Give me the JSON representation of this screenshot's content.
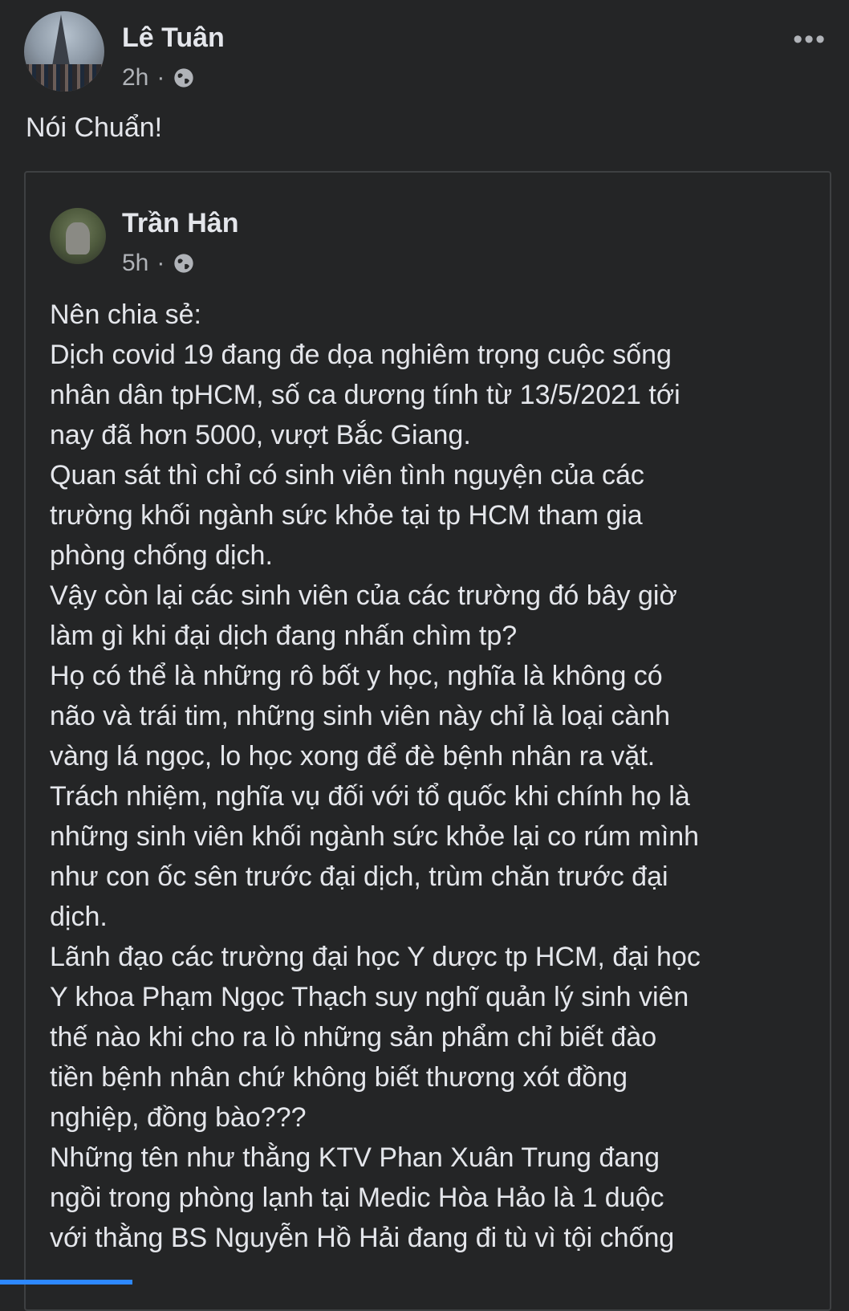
{
  "post": {
    "author": "Lê Tuân",
    "time": "2h",
    "separator": "·",
    "privacy_icon": "globe-icon",
    "more_icon": "•••",
    "text": "Nói Chuẩn!"
  },
  "shared": {
    "author": "Trần Hân",
    "time": "5h",
    "separator": "·",
    "privacy_icon": "globe-icon",
    "lines": [
      "Nên chia sẻ:",
      "Dịch covid 19 đang đe dọa nghiêm trọng cuộc sống",
      "nhân dân tpHCM, số ca dương tính từ 13/5/2021 tới",
      "nay đã hơn 5000, vượt Bắc Giang.",
      "Quan sát thì chỉ có sinh viên tình nguyện của các",
      "trường khối ngành sức khỏe tại tp HCM tham gia",
      "phòng chống dịch.",
      "Vậy còn lại các sinh viên của các trường đó bây giờ",
      "làm gì khi đại dịch đang nhấn chìm tp?",
      "Họ có thể là những rô bốt y học, nghĩa là không có",
      "não và trái tim, những sinh viên này chỉ là loại cành",
      "vàng lá ngọc, lo học xong để đè bệnh nhân ra vặt.",
      "Trách nhiệm, nghĩa vụ đối với tổ quốc khi chính họ là",
      "những sinh viên khối ngành sức khỏe lại co rúm mình",
      "như con ốc sên trước đại dịch, trùm chăn trước đại",
      "dịch.",
      "Lãnh đạo các trường đại học Y dược tp HCM, đại học",
      "Y khoa Phạm Ngọc Thạch suy nghĩ quản lý sinh viên",
      "thế nào khi cho ra lò những sản phẩm chỉ biết đào",
      "tiền bệnh nhân chứ không biết thương xót đồng",
      "nghiệp, đồng bào???",
      "Những tên như thằng KTV Phan Xuân Trung đang",
      "ngồi trong phòng lạnh tại Medic Hòa Hảo là 1 duộc",
      "với thằng BS Nguyễn Hồ Hải đang đi tù vì tội chống"
    ]
  },
  "colors": {
    "background": "#242526",
    "text": "#e4e6eb",
    "secondary_text": "#b0b3b8",
    "border": "#3e4042",
    "accent": "#2d88ff"
  }
}
